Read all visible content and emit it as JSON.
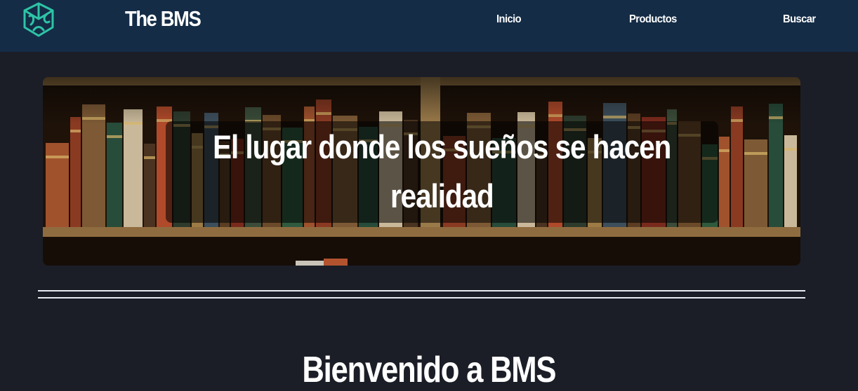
{
  "header": {
    "brand": "The BMS",
    "logo_icon": "cube-knot-logo",
    "nav": [
      {
        "label": "Inicio"
      },
      {
        "label": "Productos"
      },
      {
        "label": "Buscar"
      }
    ]
  },
  "hero": {
    "caption_line1": "El lugar donde los sueños se hacen",
    "caption_line2": "realidad",
    "image": "bookshelf-photo"
  },
  "main": {
    "welcome_title": "Bienvenido a BMS"
  },
  "colors": {
    "navbar_bg": "#142c46",
    "page_bg": "#1b1e27",
    "logo_accent": "#2ec4a6",
    "text": "#ffffff"
  }
}
